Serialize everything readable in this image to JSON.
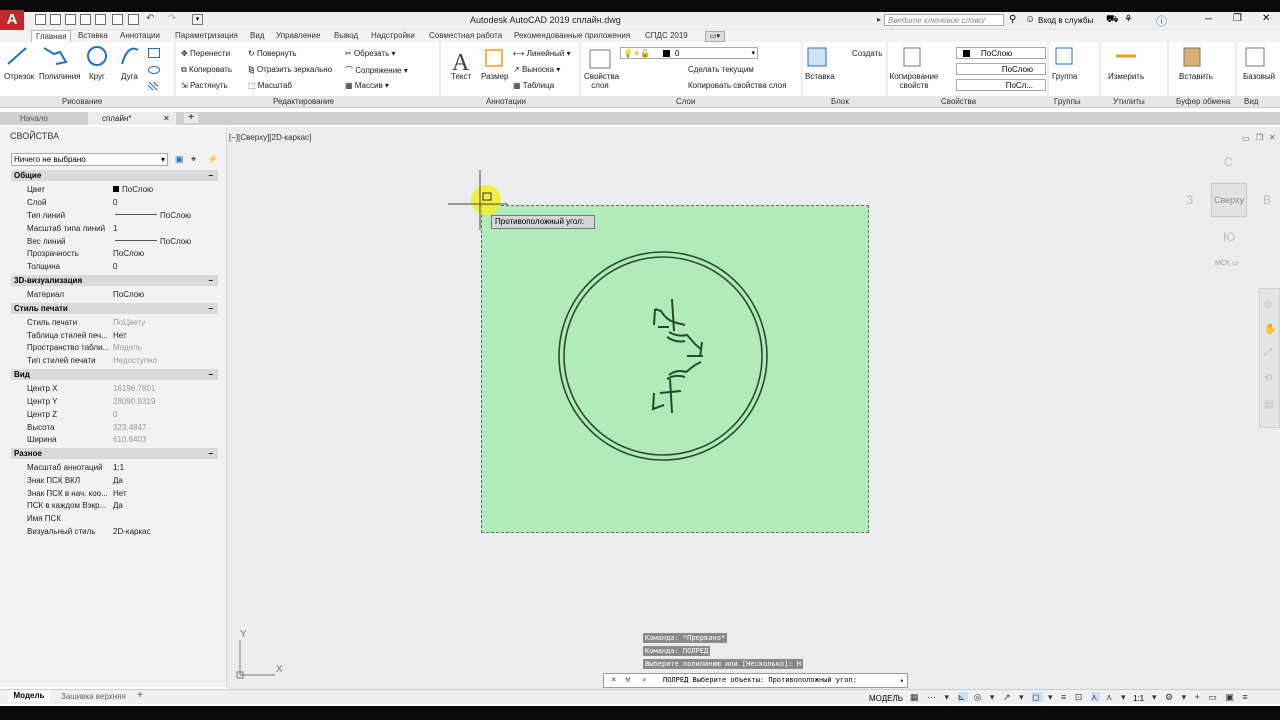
{
  "app": {
    "logo": "A",
    "title": "Autodesk AutoCAD 2019   сплайн.dwg",
    "search_placeholder": "Введите ключевое слово/фразу",
    "signin": "Вход в службы"
  },
  "ribbon_tabs": [
    "Главная",
    "Вставка",
    "Аннотации",
    "Параметризация",
    "Вид",
    "Управление",
    "Вывод",
    "Надстройки",
    "Совместная работа",
    "Рекомендованные приложения",
    "СПДС 2019"
  ],
  "draw": [
    "Отрезок",
    "Полилиния",
    "Круг",
    "Дуга"
  ],
  "modify": [
    "Перенести",
    "Повернуть",
    "Обрезать",
    "Копировать",
    "Отразить зеркально",
    "Сопряжение",
    "Растянуть",
    "Масштаб",
    "Массив"
  ],
  "annot": [
    "Текст",
    "Размер",
    "Линейный",
    "Выноска",
    "Таблица"
  ],
  "layers": {
    "props_btn": "Свойства слоя",
    "current_layer": "0",
    "make_current": "Сделать текущим",
    "copy_props": "Копировать свойства слоя"
  },
  "block": {
    "insert": "Вставка",
    "create": "Создать"
  },
  "properties_panel": {
    "match": "Копирование свойств",
    "color": "ПоСлою",
    "linetype": "ПоСлою",
    "lineweight": "ПоСл..."
  },
  "groups": {
    "group": "Группа"
  },
  "utilities": {
    "measure": "Измерить"
  },
  "clipboard": {
    "paste": "Вставить"
  },
  "view_panel": {
    "base": "Базовый"
  },
  "panel_labels": [
    "Рисование",
    "Редактирование",
    "Аннотации",
    "Слои",
    "Блок",
    "Свойства",
    "Группы",
    "Утилиты",
    "Буфер обмена",
    "Вид"
  ],
  "doc_tabs": {
    "start": "Начало",
    "current": "сплайн*"
  },
  "palette": {
    "title": "СВОЙСТВА",
    "selection": "Ничего не выбрано",
    "sections": [
      {
        "name": "Общие",
        "rows": [
          [
            "Цвет",
            "ПоСлою"
          ],
          [
            "Слой",
            "0"
          ],
          [
            "Тип линий",
            "ПоСлою"
          ],
          [
            "Масштаб типа линий",
            "1"
          ],
          [
            "Вес линий",
            "ПоСлою"
          ],
          [
            "Прозрачность",
            "ПоСлою"
          ],
          [
            "Толщина",
            "0"
          ]
        ]
      },
      {
        "name": "3D-визуализация",
        "rows": [
          [
            "Материал",
            "ПоСлою"
          ]
        ]
      },
      {
        "name": "Стиль печати",
        "rows": [
          [
            "Стиль печати",
            "ПоЦвету"
          ],
          [
            "Таблица стилей печ...",
            "Нет"
          ],
          [
            "Пространство табли...",
            "Модель"
          ],
          [
            "Тип стилей печати",
            "Недоступно"
          ]
        ]
      },
      {
        "name": "Вид",
        "rows": [
          [
            "Центр X",
            "16196.7801"
          ],
          [
            "Центр Y",
            "28090.9319"
          ],
          [
            "Центр Z",
            "0"
          ],
          [
            "Высота",
            "323.4847"
          ],
          [
            "Ширина",
            "610.6403"
          ]
        ]
      },
      {
        "name": "Разное",
        "rows": [
          [
            "Масштаб аннотаций",
            "1:1"
          ],
          [
            "Знак ПСК ВКЛ",
            "Да"
          ],
          [
            "Знак ПСК в нач. коо...",
            "Нет"
          ],
          [
            "ПСК в каждом Вэкр...",
            "Да"
          ],
          [
            "Имя ПСК",
            ""
          ],
          [
            "Визуальный стиль",
            "2D-каркас"
          ]
        ]
      }
    ]
  },
  "viewport": {
    "label": "[−][Сверху][2D-каркас]",
    "tooltip": "Противоположный угол:",
    "viewcube": {
      "n": "С",
      "w": "З",
      "e": "В",
      "s": "Ю",
      "top": "Сверху",
      "ucs": "МСК"
    }
  },
  "command": {
    "history": [
      "Команда: *Прервано*",
      "Команда: ПОЛРЕД",
      "Выберите полилинию или [Несколько]: Н"
    ],
    "current": "ПОЛРЕД Выберите объекты: Противоположный угол:"
  },
  "layout_tabs": [
    "Модель",
    "Зашивка верхняя"
  ],
  "status": {
    "model": "МОДЕЛЬ",
    "scale": "1:1"
  },
  "ucs_axes": {
    "x": "X",
    "y": "Y"
  }
}
